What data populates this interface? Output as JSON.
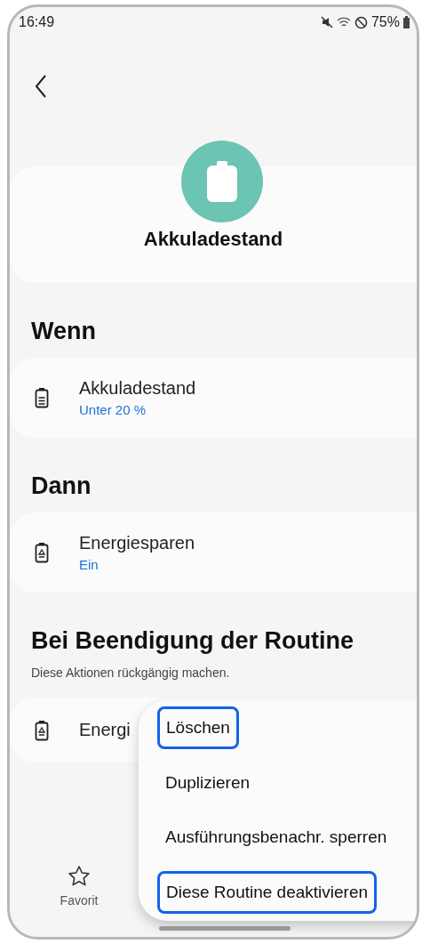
{
  "status_bar": {
    "time": "16:49",
    "battery": "75%"
  },
  "header": {
    "title": "Akkuladestand"
  },
  "sections": [
    {
      "heading": "Wenn",
      "items": [
        {
          "kind": "battery",
          "title": "Akkuladestand",
          "value": "Unter 20 %"
        }
      ]
    },
    {
      "heading": "Dann",
      "items": [
        {
          "kind": "saver",
          "title": "Energiesparen",
          "value": "Ein"
        }
      ]
    },
    {
      "heading": "Bei Beendigung der Routine",
      "subtitle": "Diese Aktionen rückgängig machen.",
      "items": [
        {
          "kind": "saver",
          "title": "Energi"
        }
      ]
    }
  ],
  "bottom_nav": [
    {
      "label": "Favorit"
    }
  ],
  "menu": [
    {
      "label": "Löschen",
      "highlighted": true
    },
    {
      "label": "Duplizieren",
      "highlighted": false
    },
    {
      "label": "Ausführungsbenachr. sperren",
      "highlighted": false
    },
    {
      "label": "Diese Routine deaktivieren",
      "highlighted": true
    }
  ]
}
